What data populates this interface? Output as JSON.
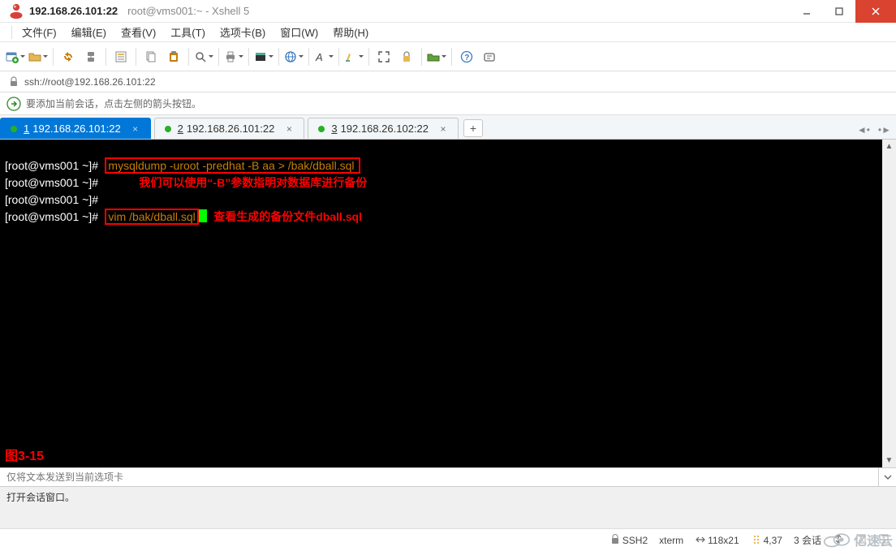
{
  "title": {
    "ip": "192.168.26.101:22",
    "suffix": "root@vms001:~ - Xshell 5"
  },
  "menu": [
    "文件(F)",
    "编辑(E)",
    "查看(V)",
    "工具(T)",
    "选项卡(B)",
    "窗口(W)",
    "帮助(H)"
  ],
  "address": {
    "url": "ssh://root@192.168.26.101:22"
  },
  "hint": "要添加当前会话，点击左侧的箭头按钮。",
  "tabs": [
    {
      "num": "1",
      "label": "192.168.26.101:22",
      "active": true
    },
    {
      "num": "2",
      "label": "192.168.26.101:22",
      "active": false
    },
    {
      "num": "3",
      "label": "192.168.26.102:22",
      "active": false
    }
  ],
  "terminal": {
    "lines": [
      {
        "prompt": "[root@vms001 ~]#",
        "cmd": "mysqldump -uroot -predhat -B aa > /bak/dball.sql",
        "boxed": true
      },
      {
        "prompt": "[root@vms001 ~]#",
        "annotation": "我们可以使用“-B”参数指明对数据库进行备份"
      },
      {
        "prompt": "[root@vms001 ~]#"
      },
      {
        "prompt": "[root@vms001 ~]#",
        "cmd": "vim /bak/dball.sql",
        "boxed": true,
        "cursor": true,
        "annotation": "查看生成的备份文件dball.sql"
      }
    ],
    "figure_label": "图3-15"
  },
  "send_placeholder": "仅将文本发送到当前选项卡",
  "message": "打开会话窗口。",
  "status": {
    "proto": "SSH2",
    "term": "xterm",
    "size": "118x21",
    "cursor": "4,37",
    "sessions": "3 会话"
  },
  "watermark_text": "亿速云"
}
